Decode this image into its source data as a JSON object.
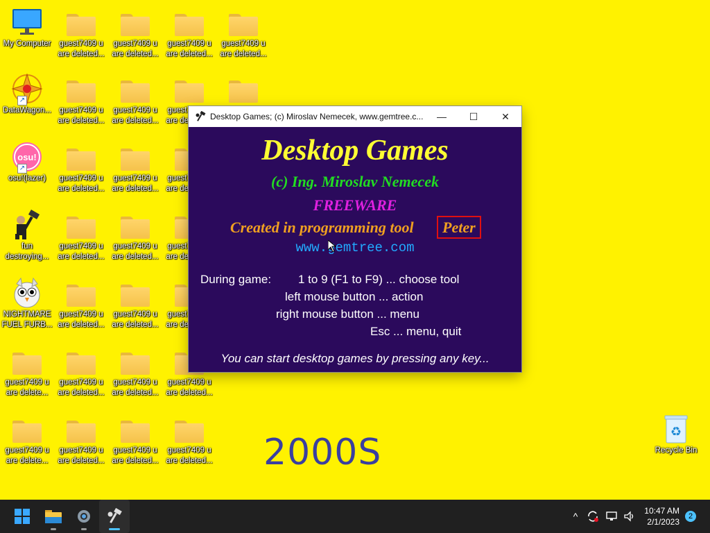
{
  "desktop": {
    "background": "#fff200",
    "wallpaper_text": "2000S",
    "icons": {
      "my_computer": "My Computer",
      "datawagon": "DataWagon...",
      "osu": "osu!(lazer)",
      "fun": "fun destroying...",
      "furby": "NIGHTMARE FUEL FURB...",
      "folder": "guest7409 u are deleted...",
      "folder_alt": "guest7409 u are delete...",
      "recycle_bin": "Recycle Bin",
      "osu_badge": "osu!"
    }
  },
  "window": {
    "title": "Desktop Games;   (c) Miroslav Nemecek, www.gemtree.c...",
    "minimize": "—",
    "maximize": "☐",
    "close": "✕",
    "content": {
      "title": "Desktop Games",
      "copyright": "(c) Ing. Miroslav Nemecek",
      "freeware": "FREEWARE",
      "created": "Created in programming tool",
      "tool_name": "Peter",
      "url": "www.gemtree.com",
      "help_label": "During game:",
      "help_lines": [
        "1 to 9 (F1 to F9) ... choose tool",
        "left mouse button ... action",
        "right mouse button ... menu",
        "Esc ... menu, quit"
      ],
      "footer": "You can start desktop games by pressing any key..."
    }
  },
  "taskbar": {
    "background": "#202020",
    "items": [
      "start-icon",
      "file-explorer-icon",
      "settings-icon",
      "desktop-games-icon"
    ],
    "tray": {
      "chevron": "^",
      "time": "10:47 AM",
      "date": "2/1/2023",
      "notifications": "2"
    }
  },
  "colors": {
    "window_content_bg": "#2b0a5c",
    "title_yellow": "#ffff33",
    "copyright_green": "#22dd22",
    "freeware_magenta": "#e020e0",
    "created_orange": "#f0a020",
    "url_blue": "#22aaff",
    "peter_border": "#e01010"
  }
}
